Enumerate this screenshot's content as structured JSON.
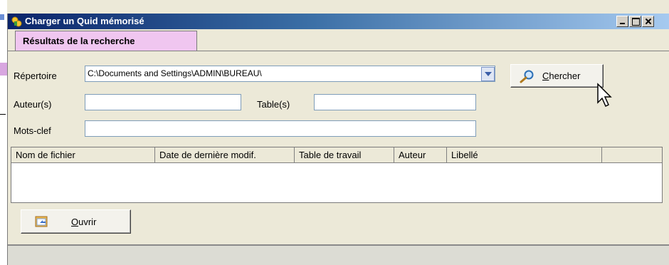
{
  "window": {
    "title": "Charger un Quid mémorisé"
  },
  "tabs": [
    {
      "label": "Résultats de la recherche"
    }
  ],
  "form": {
    "repertoire_label": "Répertoire",
    "repertoire_value": "C:\\Documents and Settings\\ADMIN\\BUREAU\\",
    "auteurs_label": "Auteur(s)",
    "auteurs_value": "",
    "tables_label": "Table(s)",
    "tables_value": "",
    "motsclef_label": "Mots-clef",
    "motsclef_value": ""
  },
  "buttons": {
    "chercher_mnemonic": "C",
    "chercher_rest": "hercher",
    "ouvrir_mnemonic": "O",
    "ouvrir_rest": "uvrir"
  },
  "grid": {
    "columns": [
      "Nom de fichier",
      "Date de dernière modif.",
      "Table de travail",
      "Auteur",
      "Libellé",
      ""
    ],
    "rows": []
  },
  "colors": {
    "tab_active": "#f0c6f0",
    "title_gradient_start": "#0a246a",
    "title_gradient_end": "#a6caf0"
  }
}
